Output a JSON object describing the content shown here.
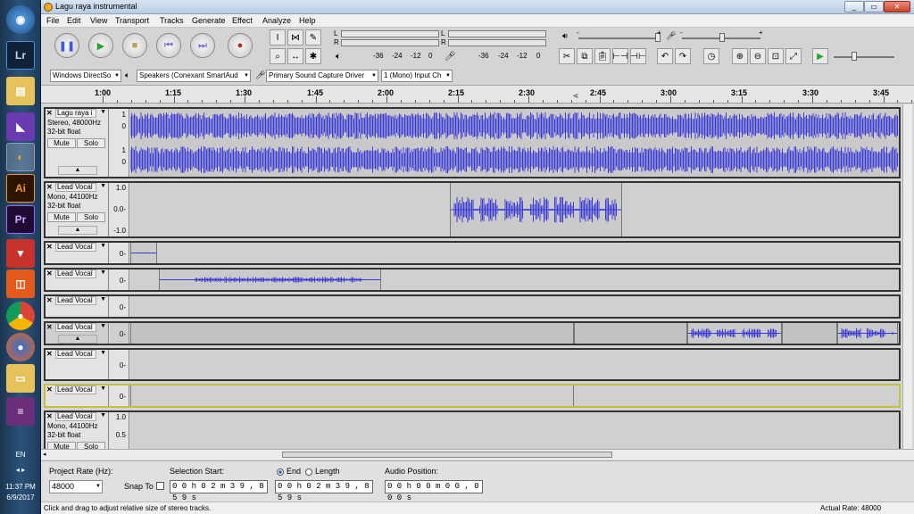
{
  "window": {
    "title": "Lagu raya instrumental"
  },
  "menu": [
    "File",
    "Edit",
    "View",
    "Transport",
    "Tracks",
    "Generate",
    "Effect",
    "Analyze",
    "Help"
  ],
  "meters": {
    "record": {
      "l": "L",
      "r": "R",
      "scale": [
        "-36",
        "-24",
        "-12",
        "0"
      ]
    },
    "playback": {
      "l": "L",
      "r": "R",
      "scale": [
        "-36",
        "-24",
        "-12",
        "0"
      ]
    },
    "slider_minus": "-",
    "slider_plus": "+"
  },
  "devices": {
    "host": "Windows DirectSo",
    "output": "Speakers (Conexant SmartAud",
    "input": "Primary Sound Capture Driver",
    "channels": "1 (Mono) Input Ch"
  },
  "ruler": {
    "ticks": [
      "1:00",
      "1:15",
      "1:30",
      "1:45",
      "2:00",
      "2:15",
      "2:30",
      "2:45",
      "3:00",
      "3:15",
      "3:30",
      "3:45"
    ]
  },
  "tracks": [
    {
      "name": "Lagu raya i",
      "info": [
        "Stereo, 48000Hz",
        "32-bit float"
      ],
      "scale": [
        "1",
        "0",
        "1",
        "0"
      ]
    },
    {
      "name": "Lead Vocal",
      "info": [
        "Mono, 44100Hz",
        "32-bit float"
      ],
      "scale": [
        "1.0",
        "0.0-",
        "-1.0"
      ]
    },
    {
      "name": "Lead Vocal",
      "scale": [
        "0-"
      ]
    },
    {
      "name": "Lead Vocal",
      "scale": [
        "0-"
      ]
    },
    {
      "name": "Lead Vocal",
      "scale": [
        "0-"
      ]
    },
    {
      "name": "Lead Vocal",
      "scale": [
        "0-"
      ]
    },
    {
      "name": "Lead Vocal",
      "scale": [
        "0-"
      ]
    },
    {
      "name": "Lead Vocal",
      "scale": [
        "0-"
      ]
    },
    {
      "name": "Lead Vocal",
      "info": [
        "Mono, 44100Hz",
        "32-bit float"
      ],
      "scale": [
        "1.0",
        "0.5"
      ]
    }
  ],
  "track_buttons": {
    "mute": "Mute",
    "solo": "Solo"
  },
  "selection": {
    "project_rate_label": "Project Rate (Hz):",
    "project_rate": "48000",
    "snap_to": "Snap To",
    "selection_start_label": "Selection Start:",
    "end_label": "End",
    "length_label": "Length",
    "audio_position_label": "Audio Position:",
    "start_time": "0 0 h 0 2 m 3 9 , 8 5 9 s",
    "end_time": "0 0 h 0 2 m 3 9 , 8 5 9 s",
    "audio_position": "0 0 h 0 0 m 0 0 , 0 0 0 s"
  },
  "status": {
    "hint": "Click and drag to adjust relative size of stereo tracks.",
    "actual_rate": "Actual Rate: 48000"
  },
  "taskbar": {
    "apps": [
      "Lr",
      "Ai",
      "Pr"
    ],
    "lang": "EN",
    "time": "11:37 PM",
    "date": "6/9/2017"
  },
  "colors": {
    "waveform": "#3b3bd6",
    "focus_border": "#c5c13d"
  }
}
